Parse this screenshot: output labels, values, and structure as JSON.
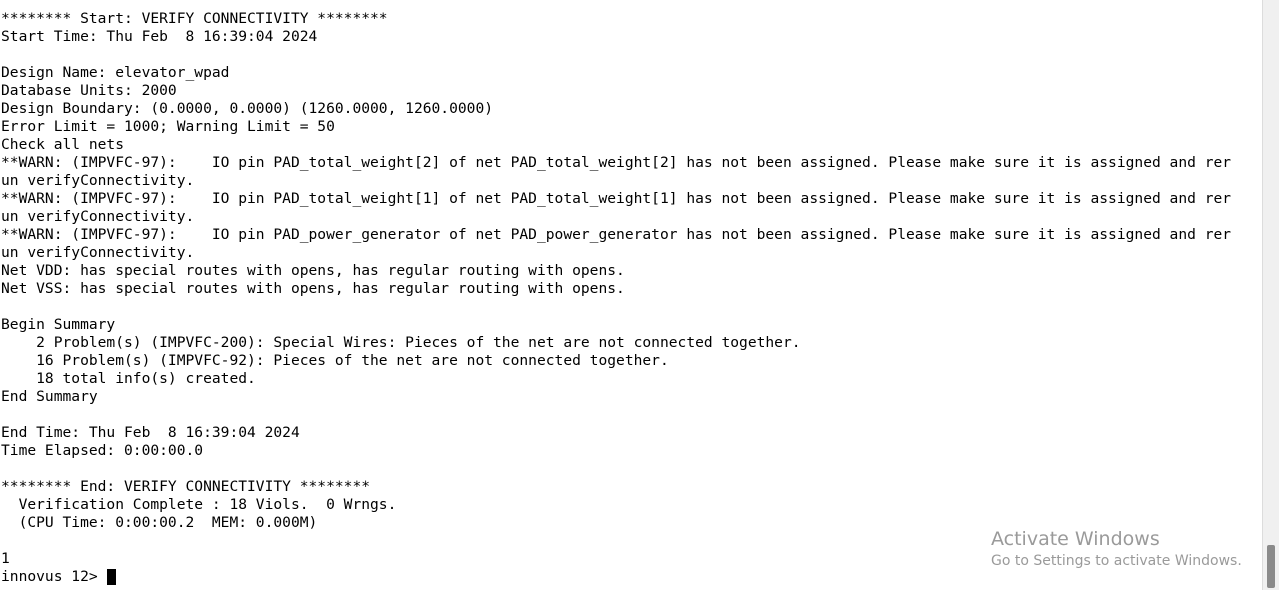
{
  "terminal": {
    "lines": [
      "******** Start: VERIFY CONNECTIVITY ********",
      "Start Time: Thu Feb  8 16:39:04 2024",
      "",
      "Design Name: elevator_wpad",
      "Database Units: 2000",
      "Design Boundary: (0.0000, 0.0000) (1260.0000, 1260.0000)",
      "Error Limit = 1000; Warning Limit = 50",
      "Check all nets",
      "**WARN: (IMPVFC-97):    IO pin PAD_total_weight[2] of net PAD_total_weight[2] has not been assigned. Please make sure it is assigned and rer",
      "un verifyConnectivity.",
      "**WARN: (IMPVFC-97):    IO pin PAD_total_weight[1] of net PAD_total_weight[1] has not been assigned. Please make sure it is assigned and rer",
      "un verifyConnectivity.",
      "**WARN: (IMPVFC-97):    IO pin PAD_power_generator of net PAD_power_generator has not been assigned. Please make sure it is assigned and rer",
      "un verifyConnectivity.",
      "Net VDD: has special routes with opens, has regular routing with opens.",
      "Net VSS: has special routes with opens, has regular routing with opens.",
      "",
      "Begin Summary",
      "    2 Problem(s) (IMPVFC-200): Special Wires: Pieces of the net are not connected together.",
      "    16 Problem(s) (IMPVFC-92): Pieces of the net are not connected together.",
      "    18 total info(s) created.",
      "End Summary",
      "",
      "End Time: Thu Feb  8 16:39:04 2024",
      "Time Elapsed: 0:00:00.0",
      "",
      "******** End: VERIFY CONNECTIVITY ********",
      "  Verification Complete : 18 Viols.  0 Wrngs.",
      "  (CPU Time: 0:00:00.2  MEM: 0.000M)",
      "",
      "1"
    ],
    "prompt": "innovus 12>"
  },
  "watermark": {
    "title": "Activate Windows",
    "subtitle": "Go to Settings to activate Windows."
  }
}
